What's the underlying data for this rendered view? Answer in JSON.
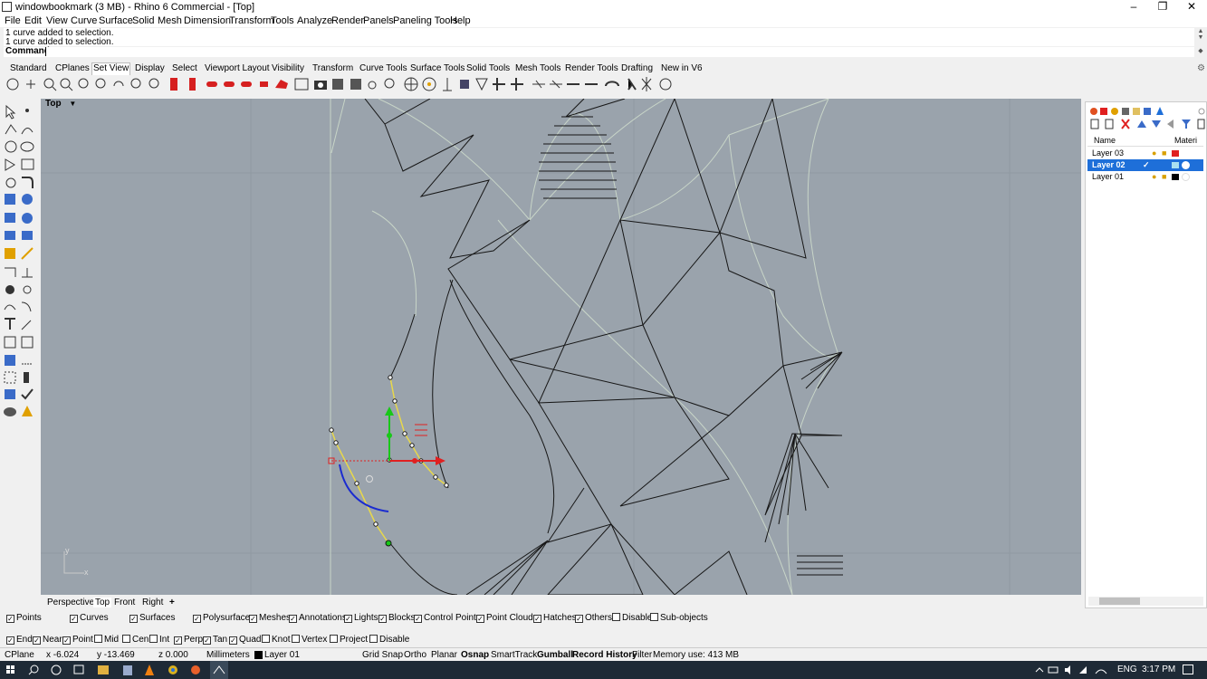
{
  "window": {
    "title": "windowbookmark (3 MB) - Rhino 6 Commercial - [Top]",
    "controls": {
      "minimize": "–",
      "restore": "❐",
      "close": "✕"
    }
  },
  "menu": [
    "File",
    "Edit",
    "View",
    "Curve",
    "Surface",
    "Solid",
    "Mesh",
    "Dimension",
    "Transform",
    "Tools",
    "Analyze",
    "Render",
    "Panels",
    "Paneling Tools",
    "Help"
  ],
  "command_history": [
    "1 curve added to selection.",
    "1 curve added to selection."
  ],
  "command": {
    "label": "Command:",
    "value": ""
  },
  "toolbar_tabs": [
    "Standard",
    "CPlanes",
    "Set View",
    "Display",
    "Select",
    "Viewport Layout",
    "Visibility",
    "Transform",
    "Curve Tools",
    "Surface Tools",
    "Solid Tools",
    "Mesh Tools",
    "Render Tools",
    "Drafting",
    "New in V6"
  ],
  "active_toolbar_tab": "Set View",
  "viewport": {
    "label": "Top",
    "menu_arrow": "▼",
    "axis_x": "x",
    "axis_y": "y"
  },
  "viewport_tabs": [
    "Perspective",
    "Top",
    "Front",
    "Right"
  ],
  "viewport_tab_add": "+",
  "active_viewport_tab": "Top",
  "layers": {
    "header_name": "Name",
    "header_material": "Materi",
    "rows": [
      {
        "name": "Layer 03",
        "color": "#e02020",
        "selected": false
      },
      {
        "name": "Layer 02",
        "color": "#a8e0f0",
        "selected": true
      },
      {
        "name": "Layer 01",
        "color": "#000000",
        "selected": false
      }
    ]
  },
  "filters": [
    {
      "label": "Points",
      "checked": true
    },
    {
      "label": "Curves",
      "checked": true
    },
    {
      "label": "Surfaces",
      "checked": true
    },
    {
      "label": "Polysurfaces",
      "checked": true
    },
    {
      "label": "Meshes",
      "checked": true
    },
    {
      "label": "Annotations",
      "checked": true
    },
    {
      "label": "Lights",
      "checked": true
    },
    {
      "label": "Blocks",
      "checked": true
    },
    {
      "label": "Control Points",
      "checked": true
    },
    {
      "label": "Point Clouds",
      "checked": true
    },
    {
      "label": "Hatches",
      "checked": true
    },
    {
      "label": "Others",
      "checked": true
    },
    {
      "label": "Disable",
      "checked": false
    },
    {
      "label": "Sub-objects",
      "checked": false
    }
  ],
  "osnaps": [
    {
      "label": "End",
      "checked": true
    },
    {
      "label": "Near",
      "checked": true
    },
    {
      "label": "Point",
      "checked": true
    },
    {
      "label": "Mid",
      "checked": false
    },
    {
      "label": "Cen",
      "checked": false
    },
    {
      "label": "Int",
      "checked": false
    },
    {
      "label": "Perp",
      "checked": true
    },
    {
      "label": "Tan",
      "checked": true
    },
    {
      "label": "Quad",
      "checked": true
    },
    {
      "label": "Knot",
      "checked": false
    },
    {
      "label": "Vertex",
      "checked": false
    },
    {
      "label": "Project",
      "checked": false
    },
    {
      "label": "Disable",
      "checked": false
    }
  ],
  "status": {
    "cplane": "CPlane",
    "x": "x -6.024",
    "y": "y -13.469",
    "z": "z 0.000",
    "units": "Millimeters",
    "layer": "Layer 01",
    "grid_snap": "Grid Snap",
    "ortho": "Ortho",
    "planar": "Planar",
    "osnap": "Osnap",
    "smarttrack": "SmartTrack",
    "gumball": "Gumball",
    "record_history": "Record History",
    "filter": "Filter",
    "memory": "Memory use: 413 MB"
  },
  "taskbar": {
    "lang": "ENG",
    "time": "3:17 PM"
  },
  "colors": {
    "viewport_bg": "#9aa3ac",
    "selection": "#1e6fd9",
    "curve_selected": "#e8d84a",
    "gumball_x": "#e02020",
    "gumball_y": "#18c818",
    "arc": "#1a2bd0"
  }
}
